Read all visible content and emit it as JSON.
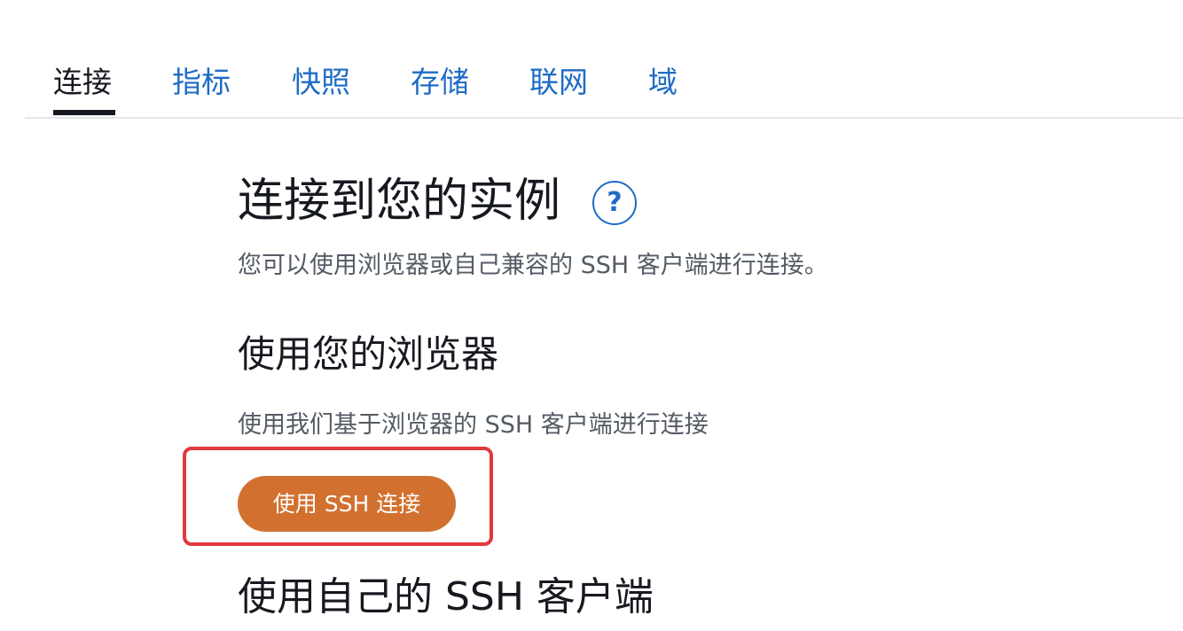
{
  "tabs": [
    {
      "label": "连接",
      "active": true
    },
    {
      "label": "指标",
      "active": false
    },
    {
      "label": "快照",
      "active": false
    },
    {
      "label": "存储",
      "active": false
    },
    {
      "label": "联网",
      "active": false
    },
    {
      "label": "域",
      "active": false
    }
  ],
  "main": {
    "title": "连接到您的实例",
    "help_icon": "?",
    "intro": "您可以使用浏览器或自己兼容的 SSH 客户端进行连接。"
  },
  "browser_section": {
    "heading": "使用您的浏览器",
    "description": "使用我们基于浏览器的 SSH 客户端进行连接",
    "button_label": "使用 SSH 连接"
  },
  "own_client_section": {
    "heading": "使用自己的 SSH 客户端"
  },
  "colors": {
    "accent_link": "#1f6cc4",
    "button": "#d2712f",
    "highlight": "#e0393e",
    "text_primary": "#16191f",
    "text_secondary": "#545b64"
  },
  "icons": {
    "help": "question-circle-icon"
  }
}
